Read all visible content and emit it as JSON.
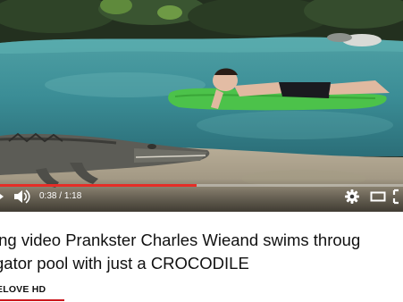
{
  "player": {
    "current_time": "0:38",
    "duration": "1:18",
    "time_separator": "/",
    "progress": 0.487,
    "colors": {
      "progress": "#e52d27",
      "track": "rgba(255,255,255,0.35)"
    },
    "icons": [
      "play-icon",
      "volume-icon",
      "gear-icon",
      "theater-mode-icon",
      "fullscreen-icon"
    ]
  },
  "video": {
    "title_line1": "ing video Prankster Charles Wieand swims throug",
    "title_line2": "gator pool with just a CROCODILE",
    "channel": "ELOVE HD"
  }
}
